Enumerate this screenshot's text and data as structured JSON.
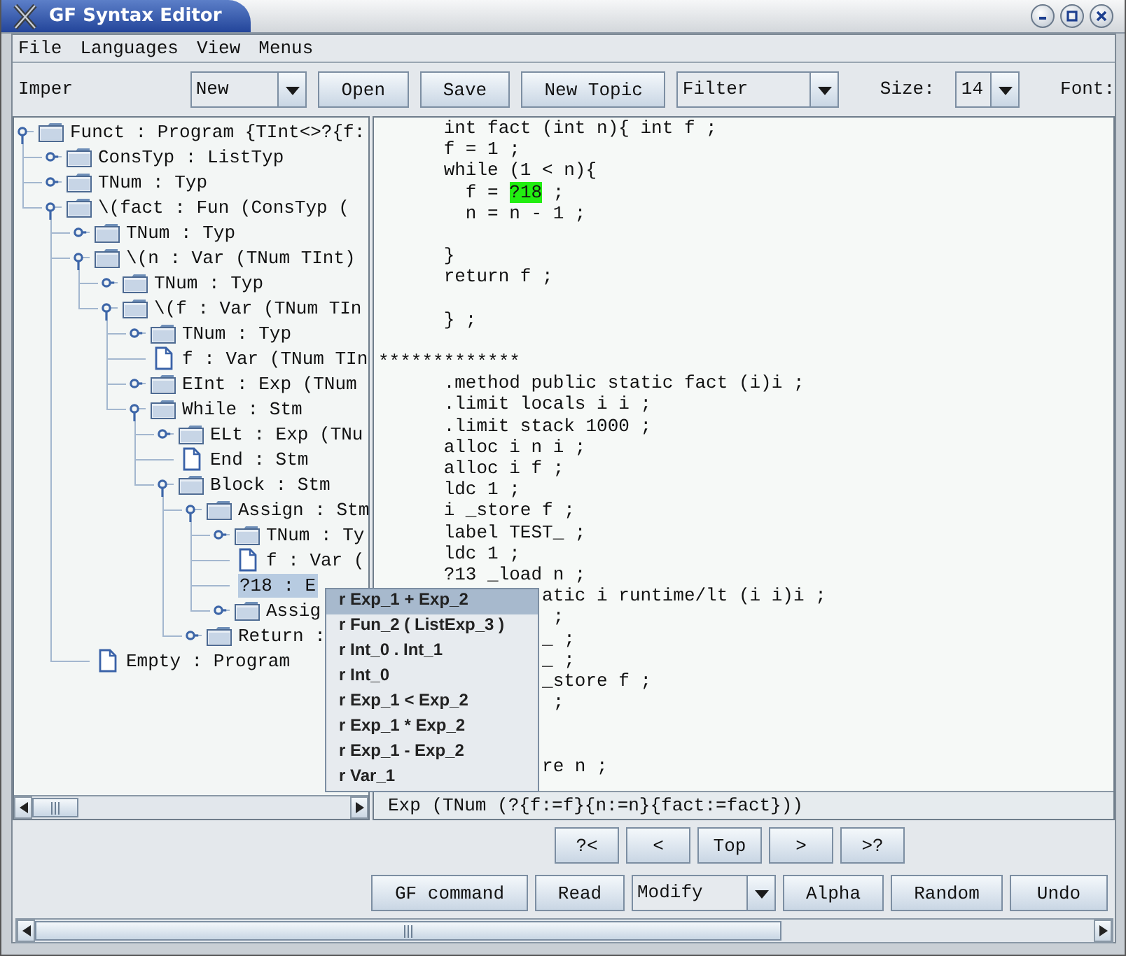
{
  "window": {
    "title": "GF Syntax Editor"
  },
  "menu": [
    "File",
    "Languages",
    "View",
    "Menus"
  ],
  "toolbar": {
    "language": "Imper",
    "new_menu": "New",
    "buttons": [
      "Open",
      "Save",
      "New Topic"
    ],
    "filter": "Filter",
    "size_label": "Size:",
    "size": "14",
    "font_label": "Font:"
  },
  "tree": [
    {
      "label": "Funct : Program {TInt<>?{f:",
      "kind": "folder",
      "expanded": true,
      "selected": false,
      "children": [
        {
          "label": "ConsTyp : ListTyp",
          "kind": "folder",
          "expanded": false,
          "selected": false
        },
        {
          "label": "TNum : Typ",
          "kind": "folder",
          "expanded": false,
          "selected": false
        },
        {
          "label": "\\(fact : Fun (ConsTyp (",
          "kind": "folder",
          "expanded": true,
          "selected": false,
          "children": [
            {
              "label": "TNum : Typ",
              "kind": "folder",
              "expanded": false,
              "selected": false
            },
            {
              "label": "\\(n : Var (TNum TInt)",
              "kind": "folder",
              "expanded": true,
              "selected": false,
              "children": [
                {
                  "label": "TNum : Typ",
                  "kind": "folder",
                  "expanded": false,
                  "selected": false
                },
                {
                  "label": "\\(f : Var (TNum TIn",
                  "kind": "folder",
                  "expanded": true,
                  "selected": false,
                  "children": [
                    {
                      "label": "TNum : Typ",
                      "kind": "folder",
                      "expanded": false,
                      "selected": false
                    },
                    {
                      "label": "f : Var (TNum TIn",
                      "kind": "leaf",
                      "selected": false
                    },
                    {
                      "label": "EInt : Exp (TNum",
                      "kind": "folder",
                      "expanded": false,
                      "selected": false
                    },
                    {
                      "label": "While : Stm",
                      "kind": "folder",
                      "expanded": true,
                      "selected": false,
                      "children": [
                        {
                          "label": "ELt : Exp (TNu",
                          "kind": "folder",
                          "expanded": false,
                          "selected": false
                        },
                        {
                          "label": "End : Stm",
                          "kind": "leaf",
                          "selected": false
                        },
                        {
                          "label": "Block : Stm",
                          "kind": "folder",
                          "expanded": true,
                          "selected": false,
                          "children": [
                            {
                              "label": "Assign : Stm",
                              "kind": "folder",
                              "expanded": true,
                              "selected": false,
                              "children": [
                                {
                                  "label": "TNum : Ty",
                                  "kind": "folder",
                                  "expanded": false,
                                  "selected": false
                                },
                                {
                                  "label": "f : Var (",
                                  "kind": "leaf",
                                  "selected": false
                                },
                                {
                                  "label": "?18 : E",
                                  "kind": "hole",
                                  "selected": true
                                },
                                {
                                  "label": "Assig",
                                  "kind": "folder",
                                  "expanded": false,
                                  "selected": false
                                }
                              ]
                            },
                            {
                              "label": "Return :",
                              "kind": "folder",
                              "expanded": false,
                              "selected": false
                            }
                          ]
                        }
                      ]
                    }
                  ]
                }
              ]
            },
            {
              "label": "Empty : Program",
              "kind": "leaf",
              "selected": false
            }
          ]
        }
      ]
    }
  ],
  "code": {
    "lines": [
      {
        "kind": "text",
        "text": "      int fact (int n){ int f ;"
      },
      {
        "kind": "text",
        "text": "      f = 1 ;"
      },
      {
        "kind": "text",
        "text": "      while (1 < n){"
      },
      {
        "kind": "marked",
        "before": "        f = ",
        "mark": "?18",
        "after": " ;"
      },
      {
        "kind": "text",
        "text": "        n = n - 1 ;"
      },
      {
        "kind": "blank"
      },
      {
        "kind": "text",
        "text": "      }"
      },
      {
        "kind": "text",
        "text": "      return f ;"
      },
      {
        "kind": "blank"
      },
      {
        "kind": "text",
        "text": "      } ;"
      },
      {
        "kind": "blank"
      },
      {
        "kind": "text",
        "text": "*************"
      },
      {
        "kind": "text",
        "text": "      .method public static fact (i)i ;"
      },
      {
        "kind": "text",
        "text": "      .limit locals i i ;"
      },
      {
        "kind": "text",
        "text": "      .limit stack 1000 ;"
      },
      {
        "kind": "text",
        "text": "      alloc i n i ;"
      },
      {
        "kind": "text",
        "text": "      alloc i f ;"
      },
      {
        "kind": "text",
        "text": "      ldc 1 ;"
      },
      {
        "kind": "text",
        "text": "      i _store f ;"
      },
      {
        "kind": "text",
        "text": "      label TEST_ ;"
      },
      {
        "kind": "text",
        "text": "      ldc 1 ;"
      },
      {
        "kind": "text",
        "text": "      ?13 _load n ;"
      },
      {
        "kind": "text",
        "text": "               atic i runtime/lt (i i)i ;"
      },
      {
        "kind": "text",
        "text": "                ;"
      },
      {
        "kind": "text",
        "text": "               _ ;"
      },
      {
        "kind": "text",
        "text": "               _ ;"
      },
      {
        "kind": "text",
        "text": "               _store f ;"
      },
      {
        "kind": "text",
        "text": "                ;"
      },
      {
        "kind": "blank"
      },
      {
        "kind": "blank"
      },
      {
        "kind": "text",
        "text": "               re n ;"
      }
    ],
    "status": "Exp (TNum (?{f:=f}{n:=n}{fact:=fact}))"
  },
  "popup": [
    {
      "label": "r Exp_1 + Exp_2",
      "selected": true
    },
    {
      "label": "r Fun_2 ( ListExp_3 )",
      "selected": false
    },
    {
      "label": "r Int_0 . Int_1",
      "selected": false
    },
    {
      "label": "r Int_0",
      "selected": false
    },
    {
      "label": "r Exp_1 < Exp_2",
      "selected": false
    },
    {
      "label": "r Exp_1 * Exp_2",
      "selected": false
    },
    {
      "label": "r Exp_1 - Exp_2",
      "selected": false
    },
    {
      "label": "r Var_1",
      "selected": false
    }
  ],
  "navigation": [
    "?<",
    "<",
    "Top",
    ">",
    ">?"
  ],
  "commands": [
    {
      "kind": "button",
      "label": "GF command"
    },
    {
      "kind": "button",
      "label": "Read"
    },
    {
      "kind": "dropdown",
      "label": "Modify"
    },
    {
      "kind": "button",
      "label": "Alpha"
    },
    {
      "kind": "button",
      "label": "Random"
    },
    {
      "kind": "button",
      "label": "Undo"
    }
  ]
}
